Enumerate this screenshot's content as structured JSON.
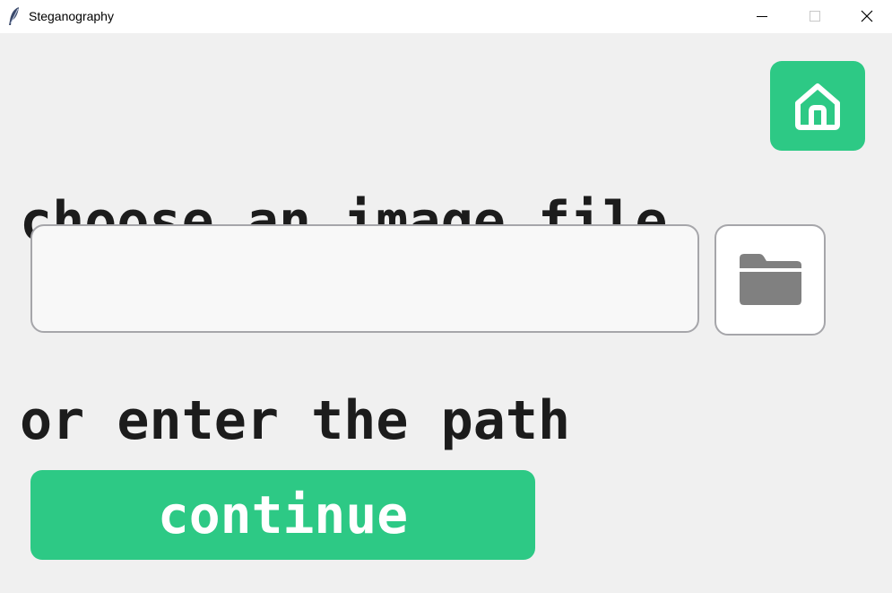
{
  "window": {
    "title": "Steganography",
    "app_icon": "feather-icon",
    "controls": [
      "minimize-icon",
      "maximize-icon",
      "close-icon"
    ]
  },
  "main": {
    "heading_line1": "choose an image file",
    "heading_line2": "or enter the path",
    "path_input": {
      "value": "",
      "placeholder": ""
    },
    "browse_icon": "folder-icon",
    "home_icon": "home-icon",
    "continue_label": "continue"
  },
  "colors": {
    "accent": "#2dc985",
    "background": "#f0f0f0",
    "heading_text": "#1c1c1c",
    "input_border": "#a6a6aa",
    "folder_icon": "#808080"
  }
}
